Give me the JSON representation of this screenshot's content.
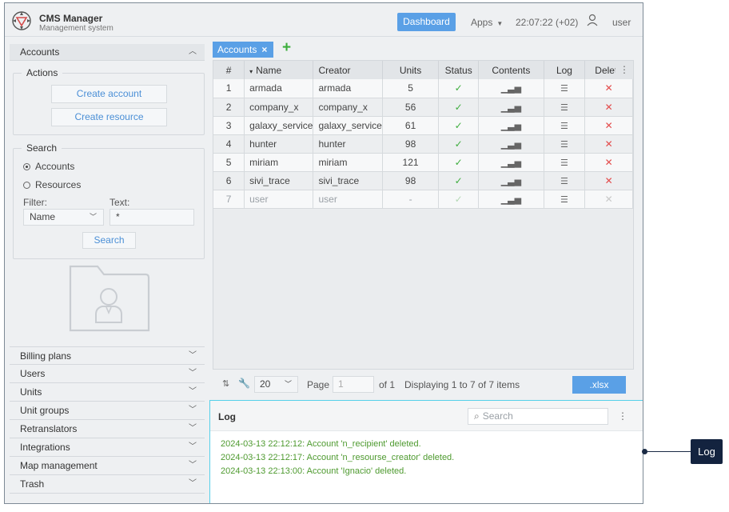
{
  "header": {
    "title": "CMS Manager",
    "subtitle": "Management system",
    "dashboard_label": "Dashboard",
    "apps_label": "Apps",
    "clock": "22:07:22 (+02)",
    "user": "user"
  },
  "sidebar": {
    "accounts_header": "Accounts",
    "actions": {
      "legend": "Actions",
      "create_account": "Create account",
      "create_resource": "Create resource"
    },
    "search": {
      "legend": "Search",
      "radio_accounts": "Accounts",
      "radio_resources": "Resources",
      "filter_label": "Filter:",
      "text_label": "Text:",
      "filter_value": "Name",
      "text_value": "*",
      "search_button": "Search"
    },
    "sections": [
      "Billing plans",
      "Users",
      "Units",
      "Unit groups",
      "Retranslators",
      "Integrations",
      "Map management",
      "Trash"
    ]
  },
  "tabs": {
    "active_tab": "Accounts",
    "close_icon": "×",
    "add_icon": "+"
  },
  "table": {
    "columns": [
      "#",
      "Name",
      "Creator",
      "Units",
      "Status",
      "Contents",
      "Log",
      "Delete"
    ],
    "sort_indicator": "▾",
    "rows": [
      {
        "num": "1",
        "name": "armada",
        "creator": "armada",
        "units": "5",
        "status": "ok",
        "muted": false
      },
      {
        "num": "2",
        "name": "company_x",
        "creator": "company_x",
        "units": "56",
        "status": "ok",
        "muted": false
      },
      {
        "num": "3",
        "name": "galaxy_service",
        "creator": "galaxy_service",
        "units": "61",
        "status": "ok",
        "muted": false
      },
      {
        "num": "4",
        "name": "hunter",
        "creator": "hunter",
        "units": "98",
        "status": "ok",
        "muted": false
      },
      {
        "num": "5",
        "name": "miriam",
        "creator": "miriam",
        "units": "121",
        "status": "ok",
        "muted": false
      },
      {
        "num": "6",
        "name": "sivi_trace",
        "creator": "sivi_trace",
        "units": "98",
        "status": "ok",
        "muted": false
      },
      {
        "num": "7",
        "name": "user",
        "creator": "user",
        "units": "-",
        "status": "ok",
        "muted": true
      }
    ]
  },
  "pager": {
    "page_size": "20",
    "page_label": "Page",
    "page_value": "1",
    "of_label": "of 1",
    "display_text": "Displaying 1 to 7 of 7 items",
    "export_label": ".xlsx"
  },
  "log": {
    "title": "Log",
    "search_placeholder": "Search",
    "lines": [
      "2024-03-13 22:12:12: Account 'n_recipient' deleted.",
      "2024-03-13 22:12:17: Account 'n_resourse_creator' deleted.",
      "2024-03-13 22:13:00: Account 'Ignacio' deleted."
    ]
  },
  "callout": {
    "label": "Log"
  },
  "colors": {
    "accent": "#5aa0e6",
    "success": "#3fae3f",
    "danger": "#e34b4b",
    "log_text": "#4e9a2f",
    "callout": "#13233f",
    "highlight_border": "#56d0ea"
  }
}
